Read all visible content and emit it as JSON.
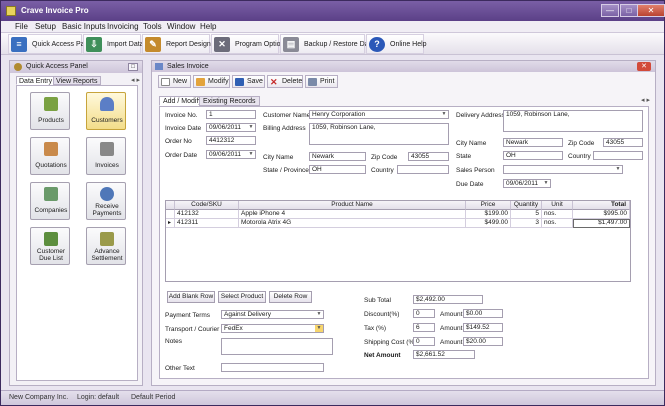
{
  "app": {
    "title": "Crave Invoice Pro"
  },
  "window_controls": {
    "minimize": "—",
    "maximize": "□",
    "close": "✕"
  },
  "menu": [
    "File",
    "Setup",
    "Basic Inputs",
    "Invoicing",
    "Tools",
    "Window",
    "Help"
  ],
  "toolbar": [
    {
      "label": "Quick Access Panel",
      "icon": "panel-icon",
      "color": "#3a6fc0"
    },
    {
      "label": "Import Data",
      "icon": "import-icon",
      "color": "#3f8f5a"
    },
    {
      "label": "Report Designer",
      "icon": "pencil-icon",
      "color": "#c48a2c"
    },
    {
      "label": "Program Options",
      "icon": "tools-icon",
      "color": "#6c6c7a"
    },
    {
      "label": "Backup / Restore Data",
      "icon": "database-icon",
      "color": "#8a8a96"
    },
    {
      "label": "Online Help",
      "icon": "help-icon",
      "color": "#2b58b8"
    }
  ],
  "quick_access": {
    "title": "Quick Access Panel",
    "tabs": [
      "Data Entry",
      "View Reports"
    ],
    "arrows": "◂ ▸",
    "tiles": [
      {
        "label": "Products",
        "icon": "box-icon",
        "color": "#7aa142"
      },
      {
        "label": "Customers",
        "icon": "person-icon",
        "color": "#5b7ec6"
      },
      {
        "label": "Quotations",
        "icon": "quote-doc-icon",
        "color": "#c98a4b"
      },
      {
        "label": "Invoices",
        "icon": "invoice-doc-icon",
        "color": "#888"
      },
      {
        "label": "Companies",
        "icon": "company-icon",
        "color": "#6a9a6a"
      },
      {
        "label": "Receive Payments",
        "icon": "dollar-coin-icon",
        "color": "#4f77b8"
      },
      {
        "label": "Customer Due List",
        "icon": "due-list-icon",
        "color": "#5c8e3e"
      },
      {
        "label": "Advance Settlement",
        "icon": "settlement-icon",
        "color": "#9a9a4a"
      }
    ]
  },
  "sales_invoice": {
    "title": "Sales Invoice",
    "toolbar": {
      "new": "New",
      "modify": "Modify",
      "save": "Save",
      "delete": "Delete",
      "print": "Print"
    },
    "tabs": [
      "Add / Modify",
      "Existing Records"
    ],
    "arrows": "◂ ▸",
    "labels": {
      "invoice_no": "Invoice No.",
      "invoice_date": "Invoice Date",
      "order_no": "Order No",
      "order_date": "Order Date",
      "customer_name": "Customer Name",
      "billing_address": "Billing Address",
      "city_name": "City Name",
      "zip_code": "Zip Code",
      "state_province": "State / Province",
      "country": "Country",
      "delivery_address": "Delivery Address",
      "sales_person": "Sales Person",
      "due_date": "Due Date",
      "state": "State",
      "payment_terms": "Payment Terms",
      "transport": "Transport / Courier",
      "notes": "Notes",
      "other_text": "Other Text",
      "sub_total": "Sub Total",
      "discount": "Discount(%)",
      "amount": "Amount",
      "tax": "Tax (%)",
      "shipping": "Shipping Cost (%)",
      "net_amount": "Net Amount"
    },
    "values": {
      "invoice_no": "1",
      "invoice_date": "09/06/2011",
      "order_no": "4412312",
      "order_date": "09/06/2011",
      "customer_name": "Henry Corporation",
      "billing_address": "1059, Robinson Lane,",
      "billing_city": "Newark",
      "billing_zip": "43055",
      "billing_state": "OH",
      "billing_country": "",
      "delivery_address": "1059, Robinson Lane,",
      "delivery_city": "Newark",
      "delivery_zip": "43055",
      "delivery_state": "OH",
      "delivery_country": "",
      "sales_person": "",
      "due_date": "09/06/2011",
      "payment_terms": "Against Delivery",
      "transport": "FedEx",
      "notes": "",
      "other_text": "",
      "sub_total": "$2,492.00",
      "discount_pct": "0",
      "discount_amt": "$0.00",
      "tax_pct": "6",
      "tax_amt": "$149.52",
      "shipping_pct": "0",
      "shipping_amt": "$20.00",
      "net_amount": "$2,661.52"
    },
    "grid": {
      "columns": [
        "Code/SKU",
        "Product Name",
        "Price",
        "Quantity",
        "Unit",
        "Total"
      ],
      "rows": [
        {
          "indicator": "",
          "code": "412132",
          "name": "Apple iPhone 4",
          "price": "$199.00",
          "qty": "5",
          "unit": "nos.",
          "total": "$995.00"
        },
        {
          "indicator": "▸",
          "code": "412311",
          "name": "Motorola Atrix 4G",
          "price": "$499.00",
          "qty": "3",
          "unit": "nos.",
          "total": "$1,497.00"
        }
      ]
    },
    "buttons": {
      "add_blank_row": "Add Blank Row",
      "select_product": "Select Product",
      "delete_row": "Delete Row"
    }
  },
  "status": {
    "company": "New Company Inc.",
    "login": "Login: default",
    "period": "Default Period"
  }
}
